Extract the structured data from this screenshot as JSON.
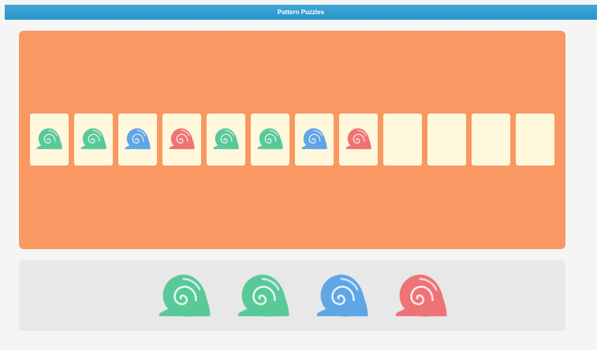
{
  "app": {
    "title": "Pattern Puzzles"
  },
  "colors": {
    "green": "#5ac99a",
    "blue": "#5ea6e6",
    "red": "#ee7375",
    "board": "#f99862",
    "card": "#fff8dc",
    "tray": "#e8e8e8"
  },
  "sequence": {
    "slots": [
      {
        "shell": "green-shell-icon",
        "color": "green"
      },
      {
        "shell": "green-shell-icon",
        "color": "green"
      },
      {
        "shell": "blue-shell-icon",
        "color": "blue"
      },
      {
        "shell": "red-shell-icon",
        "color": "red"
      },
      {
        "shell": "green-shell-icon",
        "color": "green"
      },
      {
        "shell": "green-shell-icon",
        "color": "green"
      },
      {
        "shell": "blue-shell-icon",
        "color": "blue"
      },
      {
        "shell": "red-shell-icon",
        "color": "red"
      },
      {
        "shell": null,
        "color": null
      },
      {
        "shell": null,
        "color": null
      },
      {
        "shell": null,
        "color": null
      },
      {
        "shell": null,
        "color": null
      }
    ]
  },
  "choices": [
    {
      "shell": "green-shell-icon",
      "color": "green"
    },
    {
      "shell": "green-shell-icon",
      "color": "green"
    },
    {
      "shell": "blue-shell-icon",
      "color": "blue"
    },
    {
      "shell": "red-shell-icon",
      "color": "red"
    }
  ]
}
